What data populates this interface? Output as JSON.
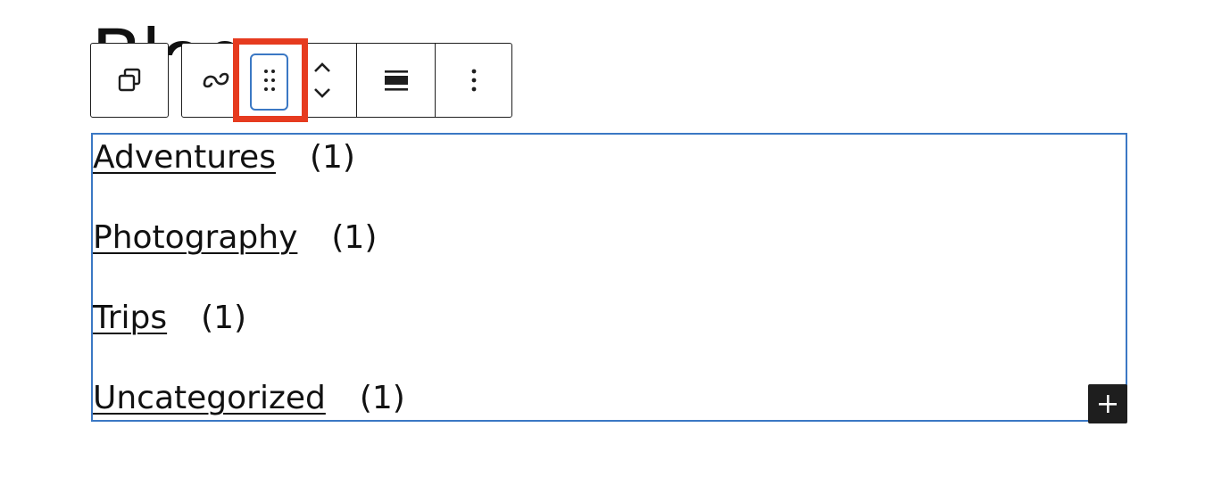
{
  "page": {
    "heading_partial": "Blog"
  },
  "toolbar": {
    "buttons": [
      {
        "name": "duplicate",
        "icon": "duplicate-icon"
      },
      {
        "name": "transform",
        "icon": "link-transform-icon"
      },
      {
        "name": "drag",
        "icon": "drag-handle-icon"
      },
      {
        "name": "move",
        "icon": "move-up-down-icon"
      },
      {
        "name": "align",
        "icon": "align-icon"
      },
      {
        "name": "options",
        "icon": "more-vertical-icon"
      }
    ]
  },
  "categories": [
    {
      "label": "Adventures",
      "count": "(1)"
    },
    {
      "label": "Photography",
      "count": "(1)"
    },
    {
      "label": "Trips",
      "count": "(1)"
    },
    {
      "label": "Uncategorized",
      "count": "(1)"
    }
  ],
  "colors": {
    "selection_border": "#3b78c4",
    "highlight": "#e63b1f",
    "add_button_bg": "#1e1e1e"
  }
}
